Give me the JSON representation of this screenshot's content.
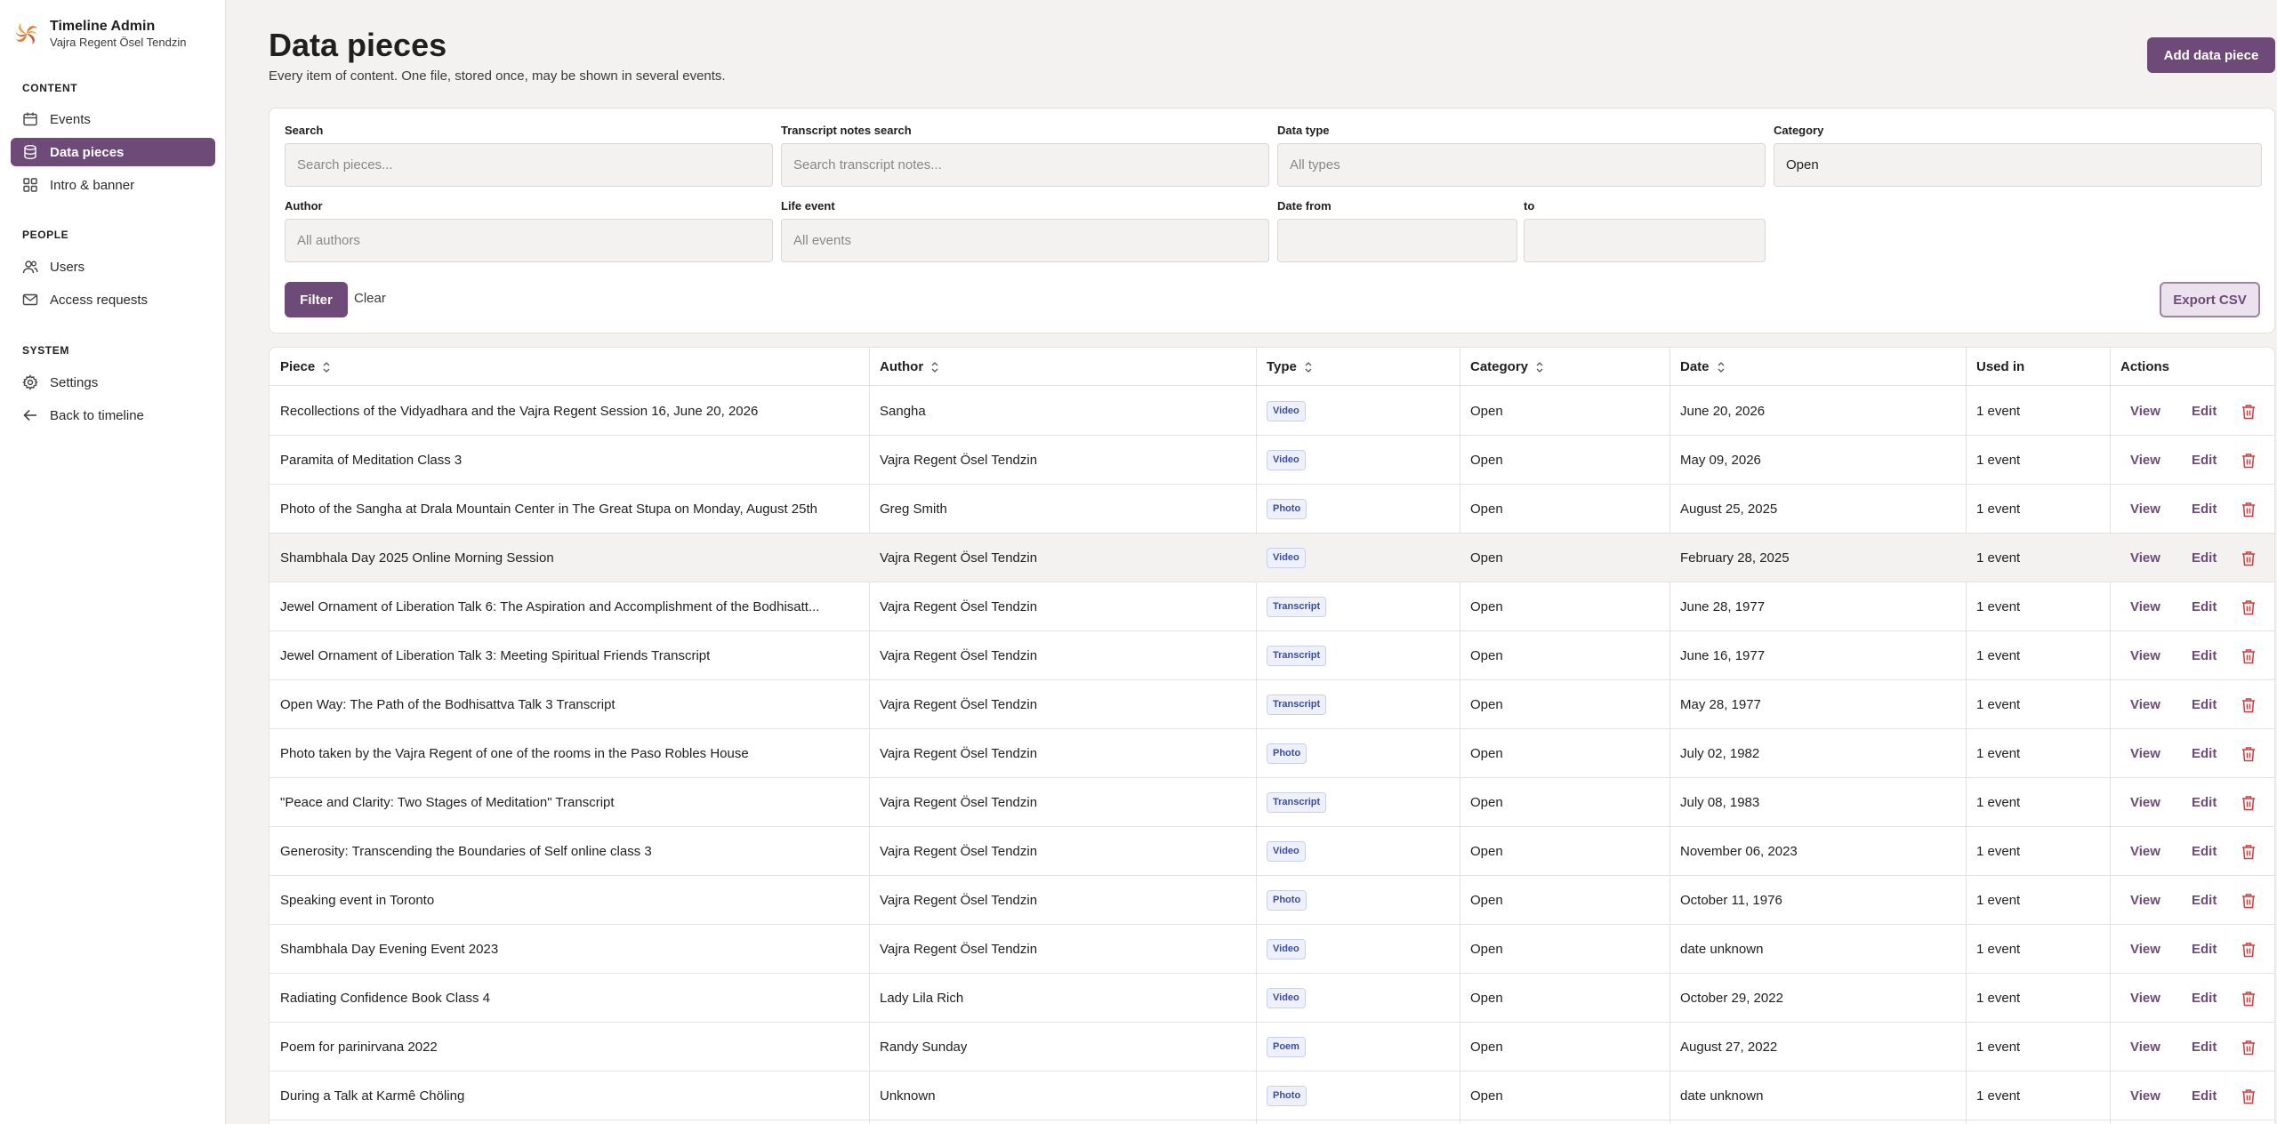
{
  "sidebar": {
    "app_title": "Timeline Admin",
    "app_subtitle": "Vajra Regent Ösel Tendzin",
    "sections": {
      "content": "CONTENT",
      "people": "PEOPLE",
      "system": "SYSTEM"
    },
    "items": {
      "events": "Events",
      "data_pieces": "Data pieces",
      "intro_banner": "Intro & banner",
      "users": "Users",
      "access_requests": "Access requests",
      "settings": "Settings",
      "back": "Back to timeline"
    },
    "active_color": "#6e4a78"
  },
  "page": {
    "title": "Data pieces",
    "subtitle": "Every item of content. One file, stored once, may be shown in several events.",
    "add_button": "Add data piece"
  },
  "filters": {
    "search": {
      "label": "Search",
      "placeholder": "Search pieces..."
    },
    "transcript": {
      "label": "Transcript notes search",
      "placeholder": "Search transcript notes..."
    },
    "data_type": {
      "label": "Data type",
      "placeholder": "All types"
    },
    "category": {
      "label": "Category",
      "value": "Open"
    },
    "author": {
      "label": "Author",
      "placeholder": "All authors"
    },
    "life_event": {
      "label": "Life event",
      "placeholder": "All events"
    },
    "date_from": {
      "label": "Date from"
    },
    "date_to": {
      "label": "to"
    },
    "filter_button": "Filter",
    "clear_link": "Clear",
    "export_button": "Export CSV"
  },
  "table": {
    "columns": {
      "piece": "Piece",
      "author": "Author",
      "type": "Type",
      "category": "Category",
      "date": "Date",
      "used_in": "Used in",
      "actions": "Actions"
    },
    "view_label": "View",
    "edit_label": "Edit",
    "badge_color": "#3b4ea0",
    "delete_color": "#d13b3b",
    "rows": [
      {
        "piece": "Recollections of the Vidyadhara and the Vajra Regent Session 16, June 20, 2026",
        "author": "Sangha",
        "type": "Video",
        "category": "Open",
        "date": "June 20, 2026",
        "used_in": "1 event"
      },
      {
        "piece": "Paramita of Meditation Class 3",
        "author": "Vajra Regent Ösel Tendzin",
        "type": "Video",
        "category": "Open",
        "date": "May 09, 2026",
        "used_in": "1 event"
      },
      {
        "piece": "Photo of the Sangha at Drala Mountain Center in The Great Stupa on Monday, August 25th",
        "author": "Greg Smith",
        "type": "Photo",
        "category": "Open",
        "date": "August 25, 2025",
        "used_in": "1 event"
      },
      {
        "piece": "Shambhala Day 2025 Online Morning Session",
        "author": "Vajra Regent Ösel Tendzin",
        "type": "Video",
        "category": "Open",
        "date": "February 28, 2025",
        "used_in": "1 event"
      },
      {
        "piece": "Jewel Ornament of Liberation Talk 6: The Aspiration and Accomplishment of the Bodhisatt...",
        "author": "Vajra Regent Ösel Tendzin",
        "type": "Transcript",
        "category": "Open",
        "date": "June 28, 1977",
        "used_in": "1 event"
      },
      {
        "piece": "Jewel Ornament of Liberation Talk 3: Meeting Spiritual Friends Transcript",
        "author": "Vajra Regent Ösel Tendzin",
        "type": "Transcript",
        "category": "Open",
        "date": "June 16, 1977",
        "used_in": "1 event"
      },
      {
        "piece": "Open Way: The Path of the Bodhisattva Talk 3 Transcript",
        "author": "Vajra Regent Ösel Tendzin",
        "type": "Transcript",
        "category": "Open",
        "date": "May 28, 1977",
        "used_in": "1 event"
      },
      {
        "piece": "Photo taken by the Vajra Regent of one of the rooms in the Paso Robles House",
        "author": "Vajra Regent Ösel Tendzin",
        "type": "Photo",
        "category": "Open",
        "date": "July 02, 1982",
        "used_in": "1 event"
      },
      {
        "piece": "\"Peace and Clarity: Two Stages of Meditation\" Transcript",
        "author": "Vajra Regent Ösel Tendzin",
        "type": "Transcript",
        "category": "Open",
        "date": "July 08, 1983",
        "used_in": "1 event"
      },
      {
        "piece": "Generosity: Transcending the Boundaries of Self online class 3",
        "author": "Vajra Regent Ösel Tendzin",
        "type": "Video",
        "category": "Open",
        "date": "November 06, 2023",
        "used_in": "1 event"
      },
      {
        "piece": "Speaking event in Toronto",
        "author": "Vajra Regent Ösel Tendzin",
        "type": "Photo",
        "category": "Open",
        "date": "October 11, 1976",
        "used_in": "1 event"
      },
      {
        "piece": "Shambhala Day Evening Event 2023",
        "author": "Vajra Regent Ösel Tendzin",
        "type": "Video",
        "category": "Open",
        "date": "date unknown",
        "used_in": "1 event"
      },
      {
        "piece": "Radiating Confidence Book Class 4",
        "author": "Lady Lila Rich",
        "type": "Video",
        "category": "Open",
        "date": "October 29, 2022",
        "used_in": "1 event"
      },
      {
        "piece": "Poem for parinirvana 2022",
        "author": "Randy Sunday",
        "type": "Poem",
        "category": "Open",
        "date": "August 27, 2022",
        "used_in": "1 event"
      },
      {
        "piece": "During a Talk at Karmê Chöling",
        "author": "Unknown",
        "type": "Photo",
        "category": "Open",
        "date": "date unknown",
        "used_in": "1 event"
      }
    ]
  }
}
